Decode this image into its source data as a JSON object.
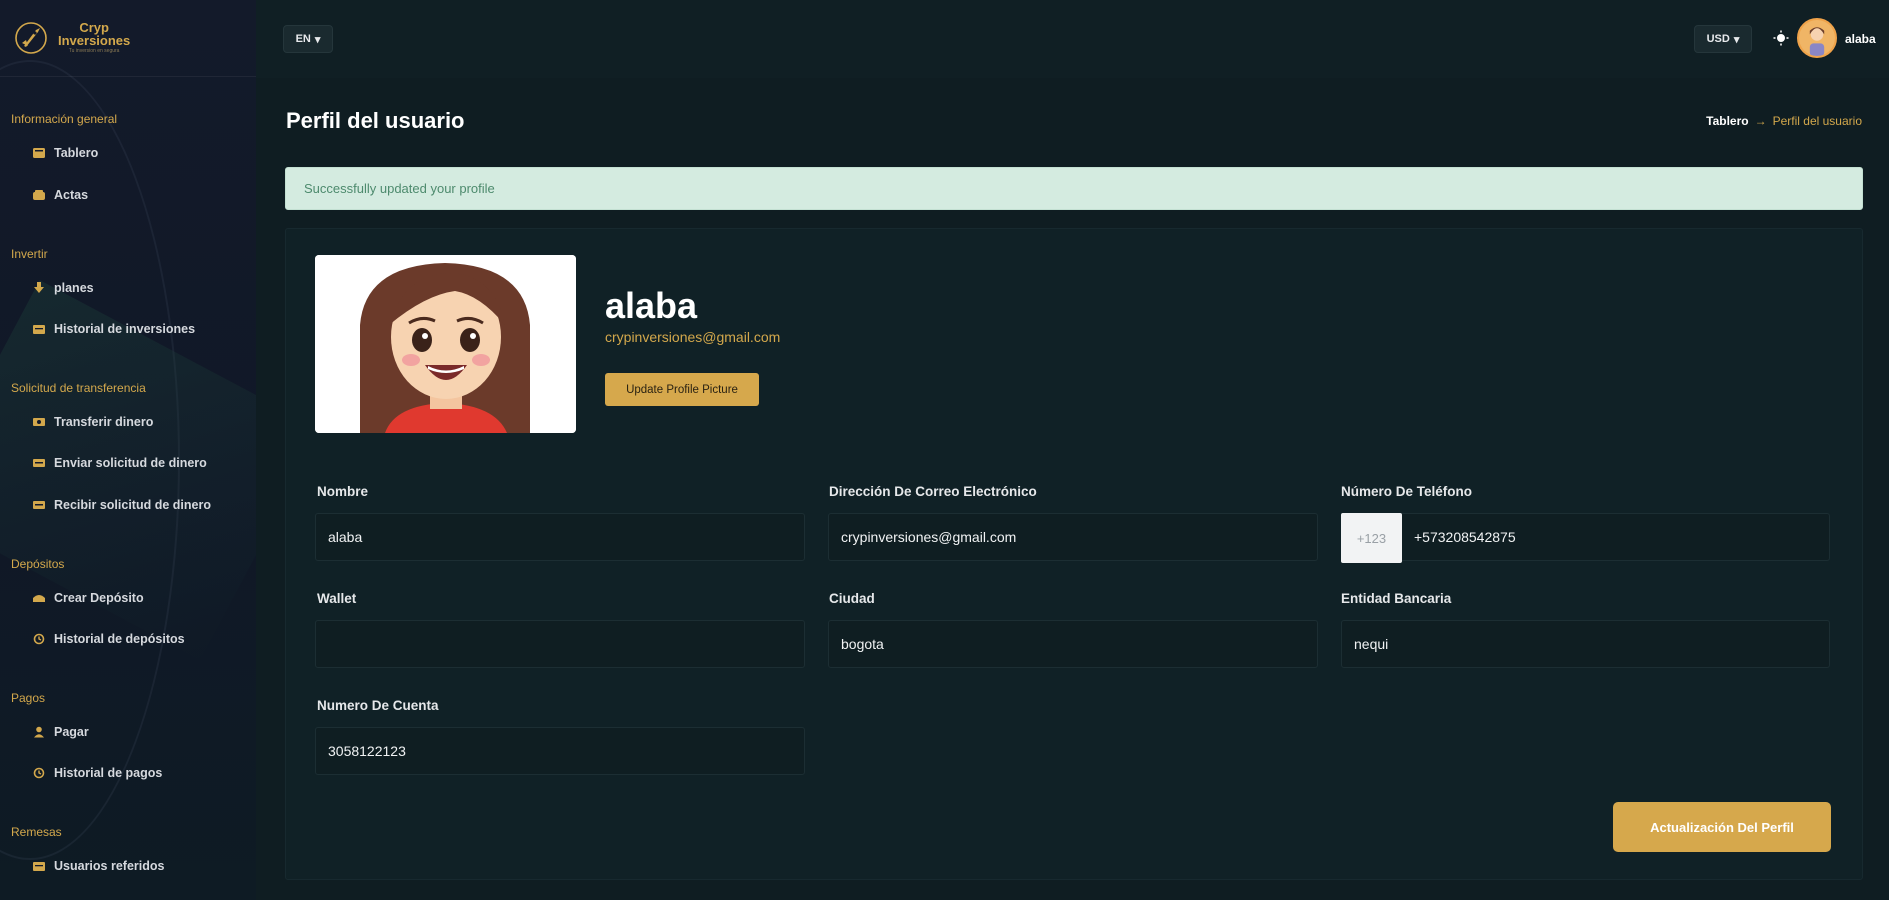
{
  "brand": {
    "line1": "Cryp",
    "line2": "Inversiones",
    "line3": "Tu inversion en segura"
  },
  "topbar": {
    "language": "EN",
    "currency": "USD",
    "username": "alaba",
    "dropdown_caret": "▾"
  },
  "sidebar": {
    "sections": [
      {
        "title": "Información general",
        "items": [
          {
            "label": "Tablero",
            "icon": "dashboard-icon"
          },
          {
            "label": "Actas",
            "icon": "wallet-icon"
          }
        ]
      },
      {
        "title": "Invertir",
        "items": [
          {
            "label": "planes",
            "icon": "download-icon"
          },
          {
            "label": "Historial de inversiones",
            "icon": "history-box-icon"
          }
        ]
      },
      {
        "title": "Solicitud de transferencia",
        "items": [
          {
            "label": "Transferir dinero",
            "icon": "transfer-icon"
          },
          {
            "label": "Enviar solicitud de dinero",
            "icon": "send-money-icon"
          },
          {
            "label": "Recibir solicitud de dinero",
            "icon": "receive-money-icon"
          }
        ]
      },
      {
        "title": "Depósitos",
        "items": [
          {
            "label": "Crear Depósito",
            "icon": "deposit-icon"
          },
          {
            "label": "Historial de depósitos",
            "icon": "history-icon"
          }
        ]
      },
      {
        "title": "Pagos",
        "items": [
          {
            "label": "Pagar",
            "icon": "user-pay-icon"
          },
          {
            "label": "Historial de pagos",
            "icon": "history-icon"
          }
        ]
      },
      {
        "title": "Remesas",
        "items": [
          {
            "label": "Usuarios referidos",
            "icon": "users-icon"
          }
        ]
      }
    ]
  },
  "page": {
    "title": "Perfil del usuario",
    "breadcrumb": {
      "home": "Tablero",
      "separator": "→",
      "current": "Perfil del usuario"
    },
    "alert": "Successfully updated your profile"
  },
  "profile": {
    "name": "alaba",
    "email": "crypinversiones@gmail.com",
    "upload_label": "Update Profile Picture"
  },
  "form": {
    "nombre": {
      "label": "Nombre",
      "value": "alaba"
    },
    "email": {
      "label": "Dirección De Correo Electrónico",
      "value": "crypinversiones@gmail.com"
    },
    "telefono": {
      "label": "Número De Teléfono",
      "prefix": "+123",
      "value": "+573208542875"
    },
    "wallet": {
      "label": "Wallet",
      "value": ""
    },
    "ciudad": {
      "label": "Ciudad",
      "value": "bogota"
    },
    "entidad": {
      "label": "Entidad Bancaria",
      "value": "nequi"
    },
    "cuenta": {
      "label": "Numero De Cuenta",
      "value": "3058122123"
    },
    "submit_label": "Actualización Del Perfil"
  },
  "colors": {
    "accent": "#d6a84c",
    "background": "#0f1d22",
    "sidebar": "#131a2a",
    "alert_bg": "#d4ebe0",
    "alert_text": "#4d8a6d"
  }
}
